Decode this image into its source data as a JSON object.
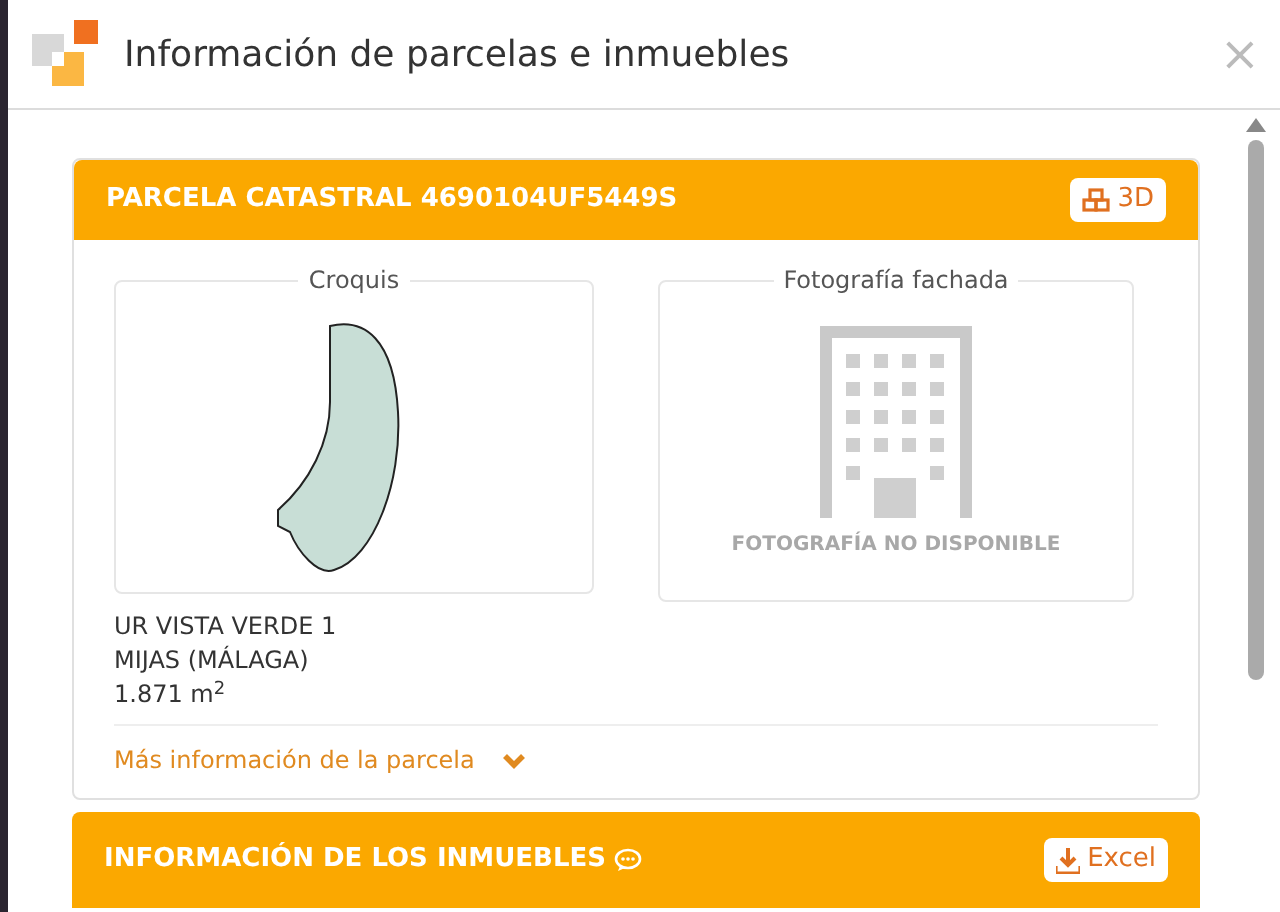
{
  "window": {
    "title": "Información de parcelas e inmuebles",
    "close": "×"
  },
  "parcel": {
    "title": "PARCELA CATASTRAL 4690104UF5449S",
    "button": "3D",
    "sketch": {
      "legend": "Croquis"
    },
    "photo": {
      "legend": "Fotografía fachada",
      "caption": "FOTOGRAFÍA NO DISPONIBLE"
    },
    "address": [
      "UR VISTA VERDE 1",
      "MIJAS (MÁLAGA)",
      "1.871 m$^{2}$"
    ],
    "more_link": {
      "label": "Más información de la parcela",
      "expanded": false
    }
  },
  "properties": {
    "title": "INFORMACIÓN DE LOS INMUEBLES",
    "button": "Excel"
  }
}
